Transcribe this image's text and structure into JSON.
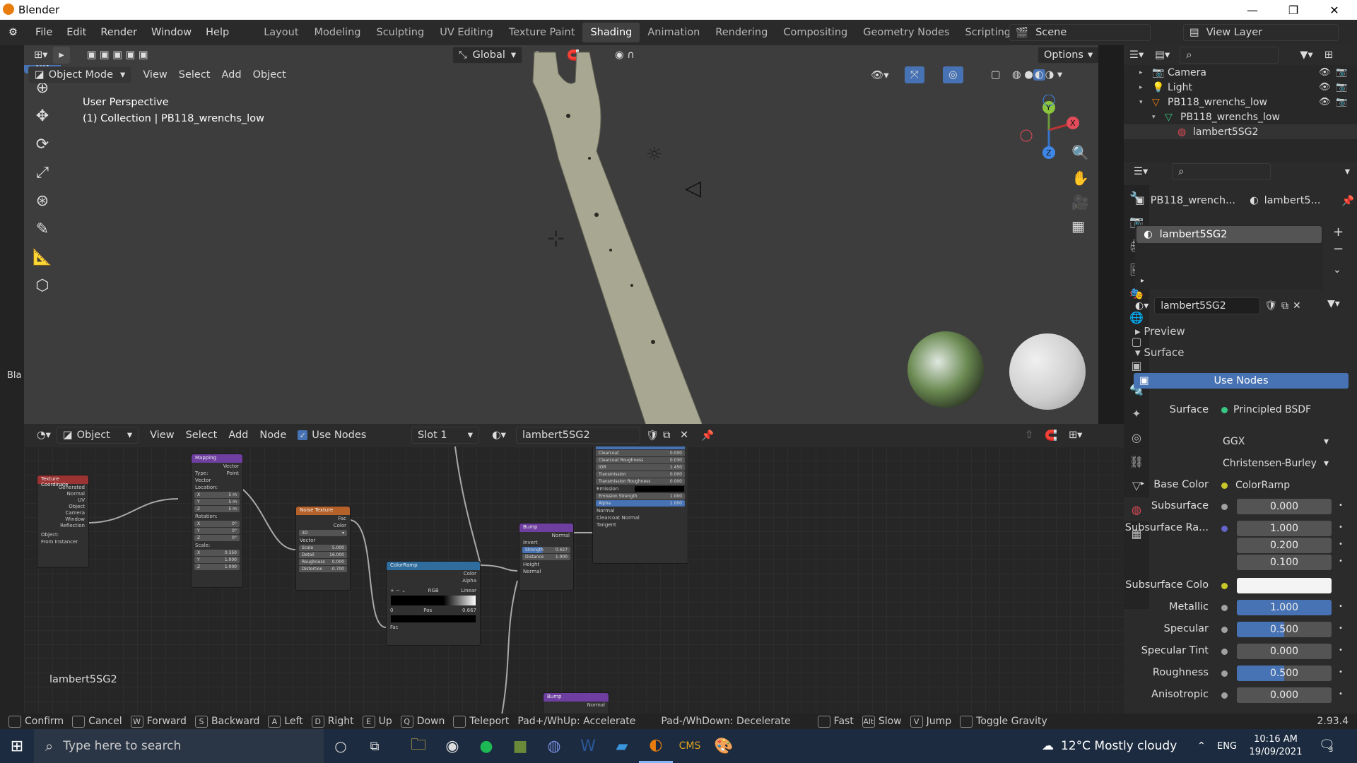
{
  "window": {
    "title": "Blender"
  },
  "menus": [
    "File",
    "Edit",
    "Render",
    "Window",
    "Help"
  ],
  "workspaces": [
    "Layout",
    "Modeling",
    "Sculpting",
    "UV Editing",
    "Texture Paint",
    "Shading",
    "Animation",
    "Rendering",
    "Compositing",
    "Geometry Nodes",
    "Scripting"
  ],
  "active_workspace": "Shading",
  "scene": {
    "label": "Scene",
    "view_layer": "View Layer"
  },
  "viewport": {
    "transform": "Global",
    "options": "Options",
    "mode": "Object Mode",
    "menus": [
      "View",
      "Select",
      "Add",
      "Object"
    ],
    "info_line1": "User Perspective",
    "info_line2": "(1) Collection | PB118_wrenchs_low",
    "side_text": "Bla"
  },
  "outliner": {
    "items": [
      "Camera",
      "Light",
      "PB118_wrenchs_low",
      "PB118_wrenchs_low",
      "lambert5SG2"
    ]
  },
  "properties": {
    "object": "PB118_wrench...",
    "material_short": "lambert5...",
    "slot": "lambert5SG2",
    "material": "lambert5SG2",
    "preview": "Preview",
    "surface_header": "Surface",
    "use_nodes": "Use Nodes",
    "surface_label": "Surface",
    "surface_value": "Principled BSDF",
    "dist": "GGX",
    "sss_method": "Christensen-Burley",
    "rows": [
      {
        "label": "Base Color",
        "value": "ColorRamp",
        "dot": "#c7c729"
      },
      {
        "label": "Subsurface",
        "value": "0.000",
        "dot": "#a1a1a1"
      },
      {
        "label": "Subsurface Ra...",
        "value": "1.000",
        "dot": "#6363c7"
      },
      {
        "label": "",
        "value": "0.200"
      },
      {
        "label": "",
        "value": "0.100"
      },
      {
        "label": "Subsurface Colo",
        "value": "",
        "dot": "#c7c729"
      },
      {
        "label": "Metallic",
        "value": "1.000",
        "dot": "#a1a1a1"
      },
      {
        "label": "Specular",
        "value": "0.500",
        "dot": "#a1a1a1"
      },
      {
        "label": "Specular Tint",
        "value": "0.000",
        "dot": "#a1a1a1"
      },
      {
        "label": "Roughness",
        "value": "0.500",
        "dot": "#a1a1a1"
      },
      {
        "label": "Anisotropic",
        "value": "0.000",
        "dot": "#a1a1a1"
      }
    ]
  },
  "node_editor": {
    "type": "Object",
    "menus": [
      "View",
      "Select",
      "Add",
      "Node"
    ],
    "use_nodes": "Use Nodes",
    "slot": "Slot 1",
    "material": "lambert5SG2",
    "footer_label": "lambert5SG2",
    "nodes": {
      "texcoord": {
        "title": "Texture Coordinate",
        "outputs": [
          "Generated",
          "Normal",
          "UV",
          "Object",
          "Camera",
          "Window",
          "Reflection"
        ],
        "object_label": "Object:",
        "from_instancer": "From Instancer"
      },
      "mapping": {
        "title": "Mapping",
        "out": "Vector",
        "type_label": "Type:",
        "type_value": "Point",
        "vector": "Vector",
        "location": "Location:",
        "loc": [
          "5 m",
          "5 m",
          "5 m"
        ],
        "rotation": "Rotation:",
        "rot": [
          "0°",
          "0°",
          "0°"
        ],
        "scale": "Scale:",
        "scl": [
          "0.350",
          "1.000",
          "1.000"
        ]
      },
      "noise": {
        "title": "Noise Texture",
        "fac": "Fac",
        "color": "Color",
        "dim": "3D",
        "vector": "Vector",
        "fields": [
          [
            "Scale",
            "5.000"
          ],
          [
            "Detail",
            "16.000"
          ],
          [
            "Roughness",
            "0.000"
          ],
          [
            "Distortion",
            "-0.700"
          ]
        ]
      },
      "ramp": {
        "title": "ColorRamp",
        "color": "Color",
        "alpha": "Alpha",
        "mode": "RGB",
        "interp": "Linear",
        "index": "0",
        "pos_label": "Pos",
        "pos": "0.667",
        "fac": "Fac"
      },
      "bump": {
        "title": "Bump",
        "normal": "Normal",
        "invert": "Invert",
        "strength": [
          "Strength",
          "0.427"
        ],
        "distance": [
          "Distance",
          "1.000"
        ],
        "height": "Height",
        "normal_in": "Normal"
      },
      "bsdf": {
        "fields": [
          [
            "Clearcoat",
            "0.000"
          ],
          [
            "Clearcoat Roughness",
            "0.030"
          ],
          [
            "IOR",
            "1.450"
          ],
          [
            "Transmission",
            "0.000"
          ],
          [
            "Transmission Roughness",
            "0.000"
          ]
        ],
        "emission": "Emission",
        "emission_strength": [
          "Emission Strength",
          "1.000"
        ],
        "alpha": [
          "Alpha",
          "1.000"
        ],
        "sockets": [
          "Normal",
          "Clearcoat Normal",
          "Tangent"
        ]
      },
      "bump2": {
        "title": "Bump",
        "normal": "Normal"
      }
    }
  },
  "statusbar": {
    "items": [
      [
        "",
        "Confirm"
      ],
      [
        "",
        "Cancel"
      ],
      [
        "W",
        "Forward"
      ],
      [
        "S",
        "Backward"
      ],
      [
        "A",
        "Left"
      ],
      [
        "D",
        "Right"
      ],
      [
        "E",
        "Up"
      ],
      [
        "Q",
        "Down"
      ],
      [
        "",
        "Teleport"
      ]
    ],
    "accel": "Pad+/WhUp: Accelerate",
    "decel": "Pad-/WhDown: Decelerate",
    "right_items": [
      [
        "",
        "Fast"
      ],
      [
        "Alt",
        "Slow"
      ],
      [
        "V",
        "Jump"
      ],
      [
        "",
        "Toggle Gravity"
      ]
    ],
    "version": "2.93.4"
  },
  "taskbar": {
    "search_placeholder": "Type here to search",
    "weather": "12°C  Mostly cloudy",
    "lang": "ENG",
    "time": "10:16 AM",
    "date": "19/09/2021",
    "notifications": "3"
  },
  "colors": {
    "accent": "#4772b3",
    "active_tab": "#404040"
  }
}
